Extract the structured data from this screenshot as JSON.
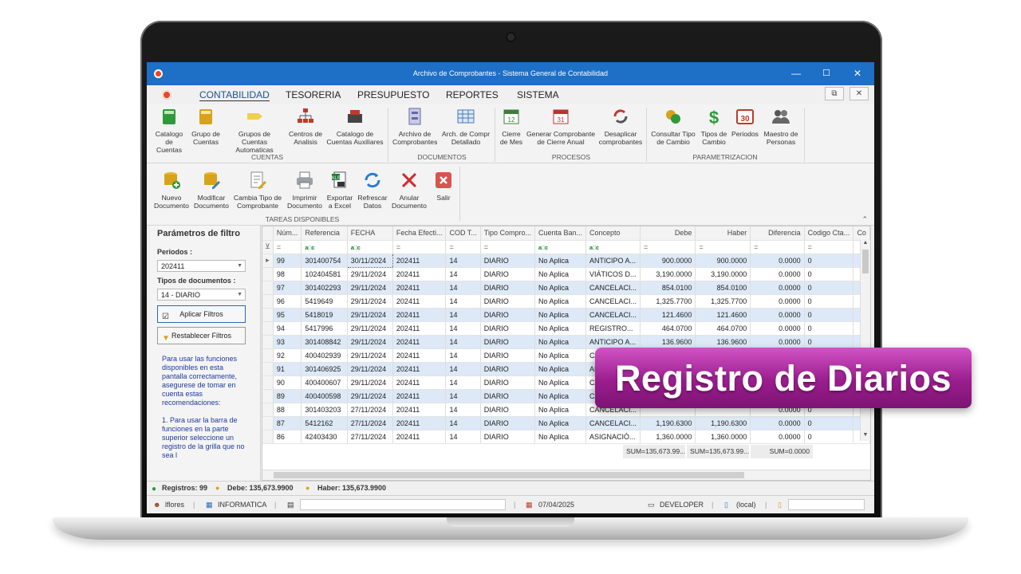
{
  "window": {
    "title": "Archivo de Comprobantes - Sistema General de Contabilidad"
  },
  "menu": [
    "CONTABILIDAD",
    "TESORERIA",
    "PRESUPUESTO",
    "REPORTES",
    "SISTEMA"
  ],
  "ribbon": {
    "cuentas": {
      "label": "CUENTAS",
      "buttons": [
        {
          "line1": "Catalogo",
          "line2": "de Cuentas"
        },
        {
          "line1": "Grupo de",
          "line2": "Cuentas"
        },
        {
          "line1": "Grupos de Cuentas",
          "line2": "Automaticas"
        },
        {
          "line1": "Centros de",
          "line2": "Analisis"
        },
        {
          "line1": "Catalogo de",
          "line2": "Cuentas Auxiliares"
        }
      ]
    },
    "documentos": {
      "label": "DOCUMENTOS",
      "buttons": [
        {
          "line1": "Archivo de",
          "line2": "Comprobantes"
        },
        {
          "line1": "Arch. de Compr",
          "line2": "Detallado"
        }
      ]
    },
    "procesos": {
      "label": "PROCESOS",
      "buttons": [
        {
          "line1": "Cierre",
          "line2": "de Mes"
        },
        {
          "line1": "Generar Comprobante",
          "line2": "de Cierre Anual"
        },
        {
          "line1": "Desaplicar",
          "line2": "comprobantes"
        }
      ]
    },
    "parametrizacion": {
      "label": "PARAMETRIZACION",
      "buttons": [
        {
          "line1": "Consultar Tipo",
          "line2": "de Cambio"
        },
        {
          "line1": "Tipos de",
          "line2": "Cambio"
        },
        {
          "line1": "Periodos",
          "line2": ""
        },
        {
          "line1": "Maestro de",
          "line2": "Personas"
        }
      ]
    }
  },
  "tasks": {
    "label": "TAREAS DISPONIBLES",
    "buttons": [
      {
        "line1": "Nuevo",
        "line2": "Documento"
      },
      {
        "line1": "Modificar",
        "line2": "Documento"
      },
      {
        "line1": "Cambia Tipo de",
        "line2": "Comprobante"
      },
      {
        "line1": "Imprimir",
        "line2": "Documento"
      },
      {
        "line1": "Exportar",
        "line2": "a Excel"
      },
      {
        "line1": "Refrescar",
        "line2": "Datos"
      },
      {
        "line1": "Anular",
        "line2": "Documento"
      },
      {
        "line1": "Salir",
        "line2": ""
      }
    ]
  },
  "filters": {
    "title": "Parámetros de filtro",
    "periodos_label": "Periodos :",
    "periodos_value": "202411",
    "tipos_label": "Tipos de documentos :",
    "tipos_value": "14 - DIARIO",
    "apply": "Aplicar Filtros",
    "reset": "Restablecer Filtros",
    "help": "Para usar las funciones disponibles en esta pantalla correctamente, asegurese de tomar en cuenta estas recomendaciones:\n\n1. Para usar la barra de funciones en la parte superior seleccione un registro de la grilla que no sea l"
  },
  "grid": {
    "columns": [
      "Núm...",
      "Referencia",
      "FECHA",
      "Fecha Efecti...",
      "COD T...",
      "Tipo Compro...",
      "Cuenta Ban...",
      "Concepto",
      "Debe",
      "Haber",
      "Diferencia",
      "Codigo Cta...",
      "Co"
    ],
    "rows": [
      [
        "99",
        "301400754",
        "30/11/2024",
        "202411",
        "14",
        "DIARIO",
        "No Aplica",
        "ANTICIPO A...",
        "900.0000",
        "900.0000",
        "0.0000",
        "0"
      ],
      [
        "98",
        "102404581",
        "29/11/2024",
        "202411",
        "14",
        "DIARIO",
        "No Aplica",
        "VIÁTICOS D...",
        "3,190.0000",
        "3,190.0000",
        "0.0000",
        "0"
      ],
      [
        "97",
        "301402293",
        "29/11/2024",
        "202411",
        "14",
        "DIARIO",
        "No Aplica",
        "CANCELACI...",
        "854.0100",
        "854.0100",
        "0.0000",
        "0"
      ],
      [
        "96",
        "5419649",
        "29/11/2024",
        "202411",
        "14",
        "DIARIO",
        "No Aplica",
        "CANCELACI...",
        "1,325.7700",
        "1,325.7700",
        "0.0000",
        "0"
      ],
      [
        "95",
        "5418019",
        "29/11/2024",
        "202411",
        "14",
        "DIARIO",
        "No Aplica",
        "CANCELACI...",
        "121.4600",
        "121.4600",
        "0.0000",
        "0"
      ],
      [
        "94",
        "5417996",
        "29/11/2024",
        "202411",
        "14",
        "DIARIO",
        "No Aplica",
        "REGISTRO...",
        "464.0700",
        "464.0700",
        "0.0000",
        "0"
      ],
      [
        "93",
        "301408842",
        "29/11/2024",
        "202411",
        "14",
        "DIARIO",
        "No Aplica",
        "ANTICIPO A...",
        "136.9600",
        "136.9600",
        "0.0000",
        "0"
      ],
      [
        "92",
        "400402939",
        "29/11/2024",
        "202411",
        "14",
        "DIARIO",
        "No Aplica",
        "CANCE",
        "",
        "",
        "",
        ""
      ],
      [
        "91",
        "301406925",
        "29/11/2024",
        "202411",
        "14",
        "DIARIO",
        "No Aplica",
        "ANTIC",
        "",
        "",
        "",
        ""
      ],
      [
        "90",
        "400400607",
        "29/11/2024",
        "202411",
        "14",
        "DIARIO",
        "No Aplica",
        "CANC",
        "",
        "",
        "",
        ""
      ],
      [
        "89",
        "400400598",
        "29/11/2024",
        "202411",
        "14",
        "DIARIO",
        "No Aplica",
        "CANC",
        "",
        "",
        "",
        ""
      ],
      [
        "88",
        "301403203",
        "27/11/2024",
        "202411",
        "14",
        "DIARIO",
        "No Aplica",
        "CANCELACI...",
        "",
        "",
        "0.0000",
        "0"
      ],
      [
        "87",
        "5412162",
        "27/11/2024",
        "202411",
        "14",
        "DIARIO",
        "No Aplica",
        "CANCELACI...",
        "1,190.6300",
        "1,190.6300",
        "0.0000",
        "0"
      ],
      [
        "86",
        "42403430",
        "27/11/2024",
        "202411",
        "14",
        "DIARIO",
        "No Aplica",
        "ASIGNACIÓ...",
        "1,360.0000",
        "1,360.0000",
        "0.0000",
        "0"
      ]
    ],
    "sum_debe": "SUM=135,673.99...",
    "sum_haber": "SUM=135,673.99...",
    "sum_dif": "SUM=0.0000"
  },
  "status": {
    "registros": "Registros: 99",
    "debe": "Debe: 135,673.9900",
    "haber": "Haber: 135,673.9900",
    "user": "lflores",
    "dept": "INFORMATICA",
    "date": "07/04/2025",
    "machine": "DEVELOPER",
    "db": "(local)"
  },
  "banner": "Registro de Diarios",
  "colors": {
    "titlebar": "#1e6fc6",
    "banner": "#9a1d8e",
    "row_alt": "#dde9f7"
  }
}
